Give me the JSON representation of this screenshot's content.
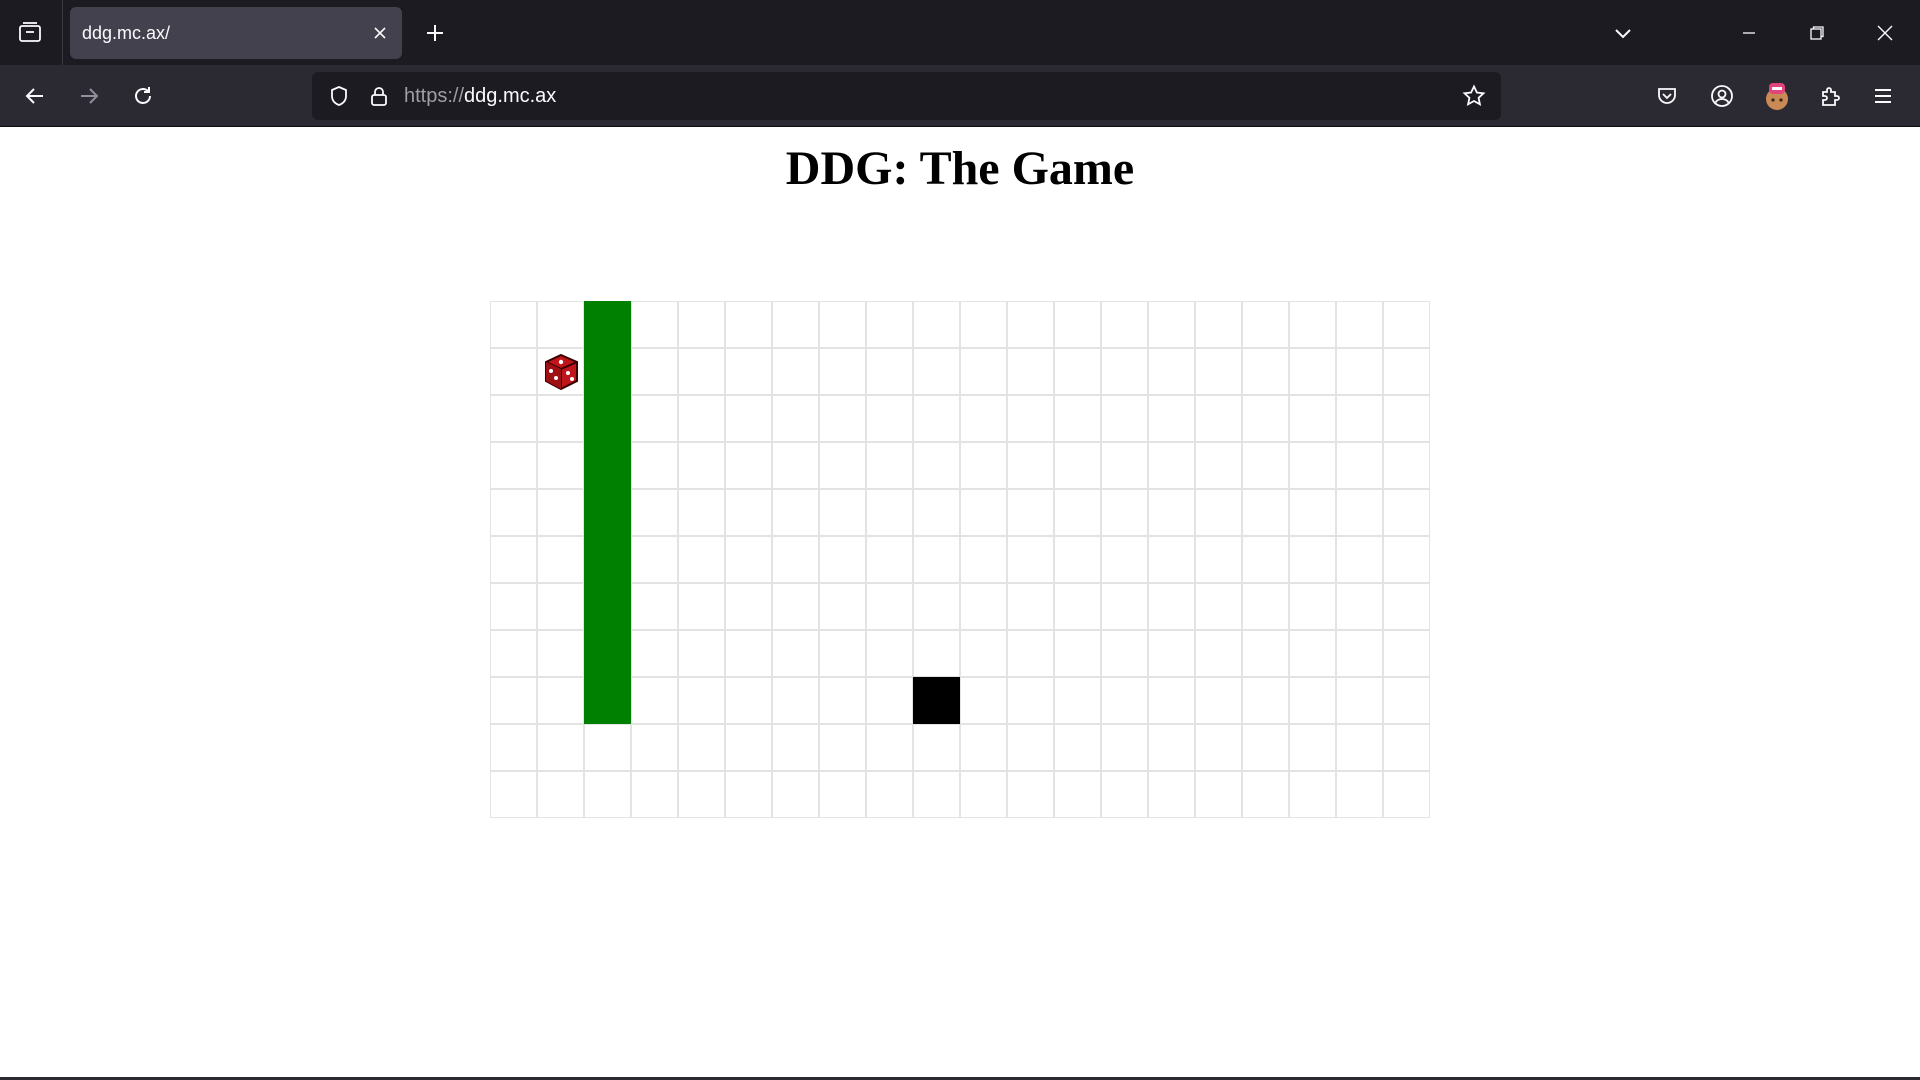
{
  "browser": {
    "tab_title": "ddg.mc.ax/",
    "url_scheme": "https://",
    "url_host": "ddg.mc.ax"
  },
  "page": {
    "title": "DDG: The Game"
  },
  "game": {
    "columns": 20,
    "rows": 11,
    "snake_color": "#008000",
    "snake_cells": [
      [
        2,
        0
      ],
      [
        2,
        1
      ],
      [
        2,
        2
      ],
      [
        2,
        3
      ],
      [
        2,
        4
      ],
      [
        2,
        5
      ],
      [
        2,
        6
      ],
      [
        2,
        7
      ],
      [
        2,
        8
      ]
    ],
    "obstacle_cells": [
      [
        9,
        8
      ]
    ],
    "player": {
      "cell": [
        1,
        1
      ],
      "icon": "red-dice-icon",
      "color": "#c0161b"
    }
  }
}
